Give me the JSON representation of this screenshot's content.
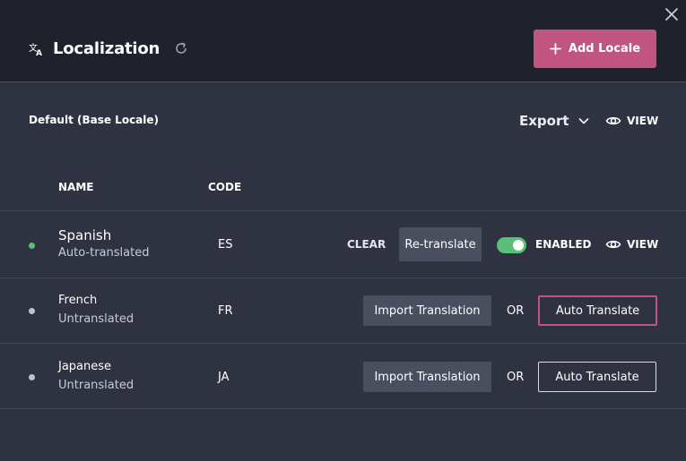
{
  "header": {
    "title": "Localization",
    "add_button_label": "Add Locale",
    "icons": {
      "title": "translate-icon",
      "refresh": "refresh-icon",
      "close": "close-icon",
      "add": "plus-icon"
    }
  },
  "base": {
    "label": "Default (Base Locale)",
    "export_label": "Export",
    "view_label": "VIEW"
  },
  "table": {
    "columns": [
      "NAME",
      "CODE"
    ],
    "rows": [
      {
        "name": "Spanish",
        "status": "Auto-translated",
        "code": "ES",
        "dot_color": "#5cbf78",
        "clear_label": "CLEAR",
        "retranslate_label": "Re-translate",
        "enabled": true,
        "enabled_label": "ENABLED",
        "view_label": "VIEW"
      },
      {
        "name": "French",
        "status": "Untranslated",
        "code": "FR",
        "dot_color": "#bfc3cc",
        "import_label": "Import Translation",
        "or_label": "OR",
        "auto_label": "Auto Translate"
      },
      {
        "name": "Japanese",
        "status": "Untranslated",
        "code": "JA",
        "dot_color": "#bfc3cc",
        "import_label": "Import Translation",
        "or_label": "OR",
        "auto_label": "Auto Translate"
      }
    ]
  },
  "colors": {
    "accent": "#c0567f",
    "header_bg": "#1f222d",
    "body_bg": "#2f3341",
    "toggle_on": "#5cbf78"
  }
}
